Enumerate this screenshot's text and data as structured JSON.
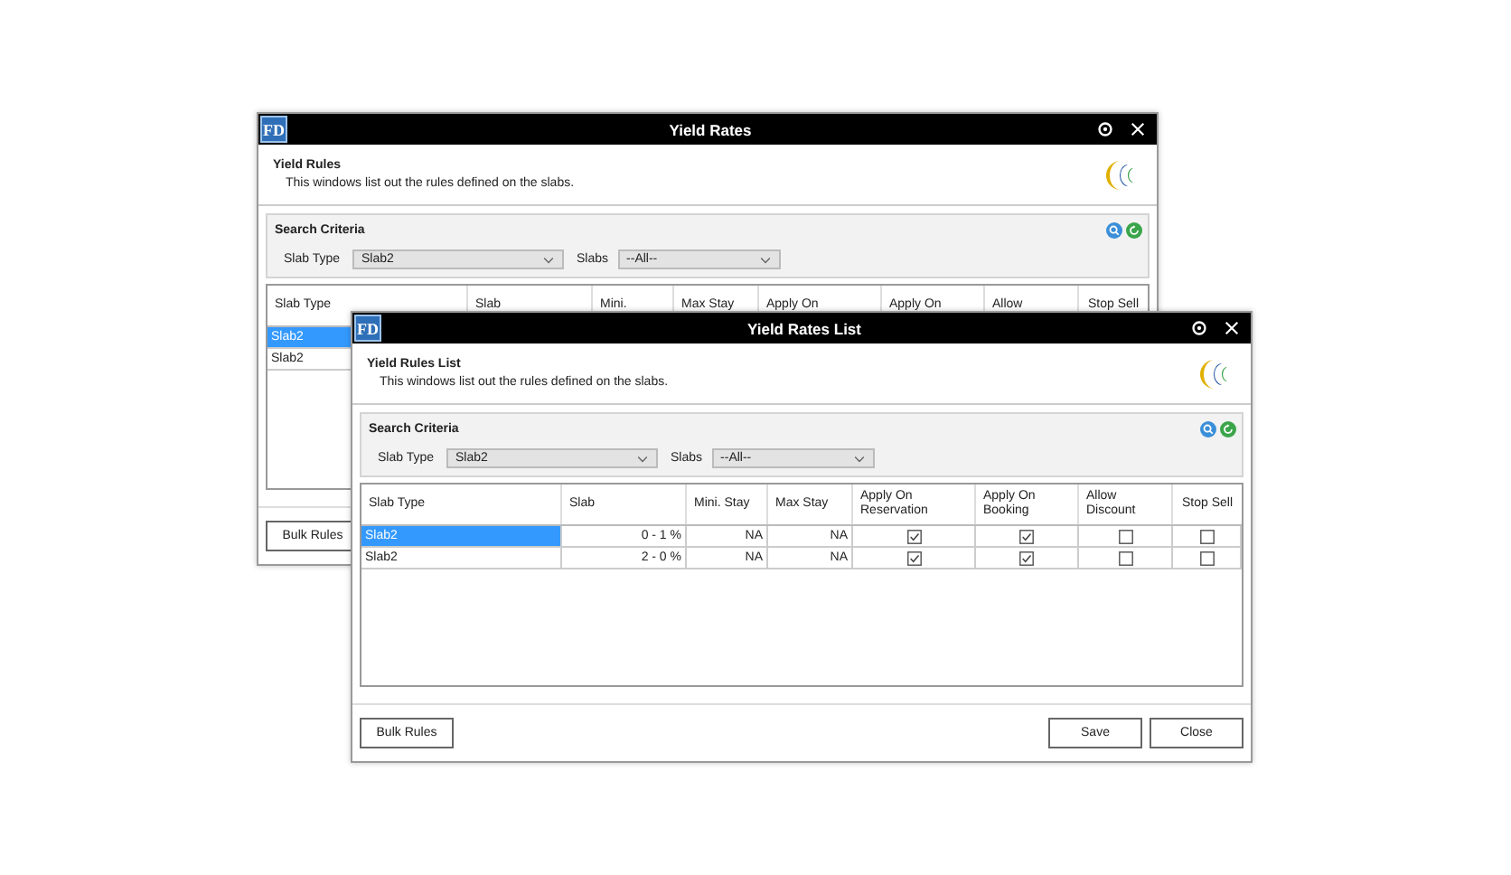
{
  "windows": [
    {
      "logo_text": "FD",
      "title": "Yield Rates",
      "heading": "Yield Rules",
      "description": "This windows list out the rules defined on the slabs.",
      "search": {
        "label": "Search Criteria",
        "slab_type_label": "Slab Type",
        "slab_type_value": "Slab2",
        "slabs_label": "Slabs",
        "slabs_value": "--All--"
      },
      "table": {
        "columns": [
          "Slab Type",
          "Slab",
          "Mini.",
          "Max Stay",
          "Apply On",
          "Apply On",
          "Allow",
          "Stop Sell"
        ],
        "rows": [
          {
            "selected": true,
            "cells": [
              {
                "kind": "text",
                "text": "Slab2"
              }
            ]
          },
          {
            "selected": false,
            "cells": [
              {
                "kind": "text",
                "text": "Slab2"
              }
            ]
          }
        ]
      },
      "buttons": [
        "Bulk Rules"
      ]
    },
    {
      "logo_text": "FD",
      "title": "Yield Rates List",
      "heading": "Yield Rules List",
      "description": "This windows list out the rules defined on the slabs.",
      "search": {
        "label": "Search Criteria",
        "slab_type_label": "Slab Type",
        "slab_type_value": "Slab2",
        "slabs_label": "Slabs",
        "slabs_value": "--All--"
      },
      "table": {
        "columns": [
          "Slab Type",
          "Slab",
          "Mini. Stay",
          "Max Stay",
          "Apply On Reservation",
          "Apply On Booking",
          "Allow Discount",
          "Stop Sell"
        ],
        "rows": [
          {
            "selected": true,
            "cells": [
              {
                "kind": "text",
                "text": "Slab2"
              },
              {
                "kind": "number",
                "text": "0 - 1 %"
              },
              {
                "kind": "number",
                "text": "NA"
              },
              {
                "kind": "number",
                "text": "NA"
              },
              {
                "kind": "check",
                "checked": true
              },
              {
                "kind": "check",
                "checked": true
              },
              {
                "kind": "check",
                "checked": false
              },
              {
                "kind": "check",
                "checked": false
              }
            ]
          },
          {
            "selected": false,
            "cells": [
              {
                "kind": "text",
                "text": "Slab2"
              },
              {
                "kind": "number",
                "text": "2 - 0 %"
              },
              {
                "kind": "number",
                "text": "NA"
              },
              {
                "kind": "number",
                "text": "NA"
              },
              {
                "kind": "check",
                "checked": true
              },
              {
                "kind": "check",
                "checked": true
              },
              {
                "kind": "check",
                "checked": false
              },
              {
                "kind": "check",
                "checked": false
              }
            ]
          }
        ]
      },
      "buttons": [
        "Bulk Rules",
        "Save",
        "Close"
      ]
    }
  ]
}
